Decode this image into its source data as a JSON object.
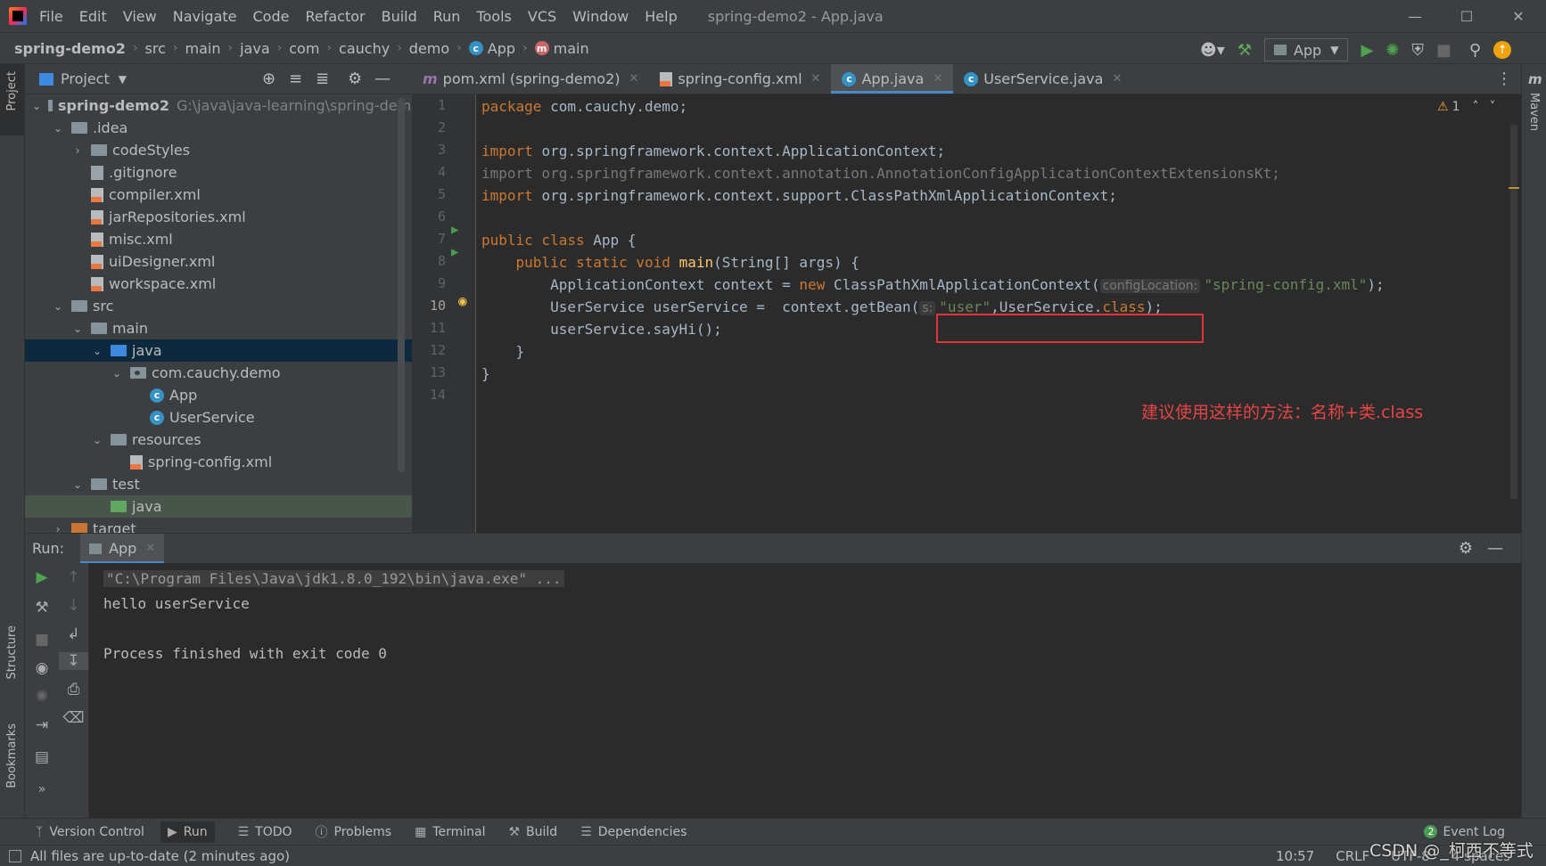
{
  "menu": [
    "File",
    "Edit",
    "View",
    "Navigate",
    "Code",
    "Refactor",
    "Build",
    "Run",
    "Tools",
    "VCS",
    "Window",
    "Help"
  ],
  "window_title": "spring-demo2 - App.java",
  "breadcrumbs": [
    "spring-demo2",
    "src",
    "main",
    "java",
    "com",
    "cauchy",
    "demo",
    "App",
    "main"
  ],
  "run_config": "App",
  "project_panel": {
    "title": "Project",
    "root_name": "spring-demo2",
    "root_path": "G:\\java\\java-learning\\spring-demc",
    "items": [
      {
        "label": ".idea"
      },
      {
        "label": "codeStyles"
      },
      {
        "label": ".gitignore"
      },
      {
        "label": "compiler.xml"
      },
      {
        "label": "jarRepositories.xml"
      },
      {
        "label": "misc.xml"
      },
      {
        "label": "uiDesigner.xml"
      },
      {
        "label": "workspace.xml"
      },
      {
        "label": "src"
      },
      {
        "label": "main"
      },
      {
        "label": "java"
      },
      {
        "label": "com.cauchy.demo"
      },
      {
        "label": "App"
      },
      {
        "label": "UserService"
      },
      {
        "label": "resources"
      },
      {
        "label": "spring-config.xml"
      },
      {
        "label": "test"
      },
      {
        "label": "java"
      },
      {
        "label": "target"
      }
    ]
  },
  "editor_tabs": [
    {
      "label": "pom.xml (spring-demo2)"
    },
    {
      "label": "spring-config.xml"
    },
    {
      "label": "App.java"
    },
    {
      "label": "UserService.java"
    }
  ],
  "editor": {
    "warning_count": "1",
    "line_numbers": [
      "1",
      "2",
      "3",
      "4",
      "5",
      "6",
      "7",
      "8",
      "9",
      "10",
      "11",
      "12",
      "13",
      "14"
    ],
    "code": {
      "l1_kw": "package ",
      "l1_rest": "com.cauchy.demo;",
      "l3_kw": "import ",
      "l3_rest": "org.springframework.context.ApplicationContext;",
      "l4": "import org.springframework.context.annotation.AnnotationConfigApplicationContextExtensionsKt;",
      "l5_kw": "import ",
      "l5_rest": "org.springframework.context.support.ClassPathXmlApplicationContext;",
      "l7_kw": "public class ",
      "l7_rest": "App {",
      "l8_kw": "    public static void ",
      "l8_fn": "main",
      "l8_rest": "(String[] args) {",
      "l9_a": "        ApplicationContext context = ",
      "l9_kw": "new ",
      "l9_b": "ClassPathXmlApplicationContext(",
      "l9_hint": "configLocation:",
      "l9_str": "\"spring-config.xml\"",
      "l9_end": ");",
      "l10_a": "        UserService userService =  context.getBean(",
      "l10_hint": "s:",
      "l10_str": "\"user\"",
      "l10_b": ",UserService.",
      "l10_kw": "class",
      "l10_end": ");",
      "l11": "        userService.sayHi();",
      "l12": "    }",
      "l13": "}"
    },
    "annotation": "建议使用这样的方法：名称+类.class"
  },
  "run_panel": {
    "label": "Run:",
    "tab": "App",
    "output": [
      "\"C:\\Program Files\\Java\\jdk1.8.0_192\\bin\\java.exe\" ...",
      "hello userService",
      "",
      "Process finished with exit code 0"
    ]
  },
  "bottom_tabs": [
    "Version Control",
    "Run",
    "TODO",
    "Problems",
    "Terminal",
    "Build",
    "Dependencies"
  ],
  "event_log": {
    "label": "Event Log",
    "count": "2"
  },
  "status": {
    "message": "All files are up-to-date (2 minutes ago)",
    "time": "10:57",
    "line_sep": "CRLF",
    "encoding": "UTF-8",
    "indent": "4 spaces"
  },
  "side_labels": {
    "project": "Project",
    "structure": "Structure",
    "bookmarks": "Bookmarks",
    "maven": "Maven"
  },
  "watermark": "CSDN @_柯西不等式",
  "colors": {
    "accent": "#4a88c7",
    "highlight_box": "#e0323b",
    "annotation": "#e64545",
    "keyword": "#cc7832",
    "string": "#6a8759"
  }
}
